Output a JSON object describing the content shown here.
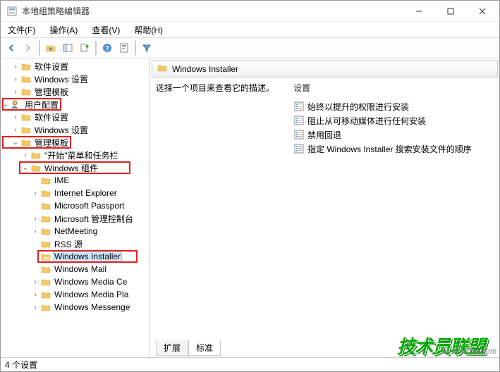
{
  "window": {
    "title": "本地组策略编辑器"
  },
  "menu": {
    "file": "文件(F)",
    "action": "操作(A)",
    "view": "查看(V)",
    "help": "帮助(H)"
  },
  "tree": {
    "i0": "软件设置",
    "i1": "Windows 设置",
    "i2": "管理模板",
    "i3": "用户配置",
    "i4": "软件设置",
    "i5": "Windows 设置",
    "i6": "管理模板",
    "i7": "\"开始\"菜单和任务栏",
    "i8": "Windows 组件",
    "i9": "IME",
    "i10": "Internet Explorer",
    "i11": "Microsoft Passport",
    "i12": "Microsoft 管理控制台",
    "i13": "NetMeeting",
    "i14": "RSS 源",
    "i15": "Windows Installer",
    "i16": "Windows Mail",
    "i17": "Windows Media Ce",
    "i18": "Windows Media Pla",
    "i19": "Windows Messenge"
  },
  "right": {
    "header": "Windows Installer",
    "desc": "选择一个项目来查看它的描述。",
    "colSetting": "设置",
    "s0": "始终以提升的权限进行安装",
    "s1": "阻止从可移动媒体进行任何安装",
    "s2": "禁用回退",
    "s3": "指定 Windows Installer 搜索安装文件的顺序"
  },
  "tabs": {
    "ext": "扩展",
    "std": "标准"
  },
  "status": "4 个设置",
  "watermark": {
    "url": "www.jsgho.com",
    "logo": "技术员联盟"
  }
}
